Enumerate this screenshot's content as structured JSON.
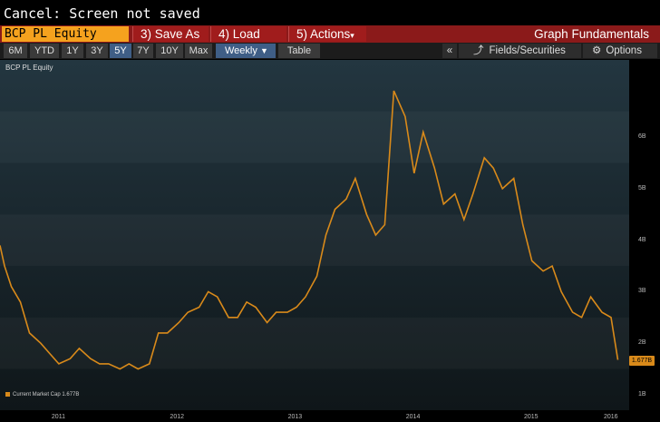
{
  "window": {
    "status_line": "Cancel: Screen not saved"
  },
  "command_bar": {
    "ticker": "BCP PL Equity",
    "save_as": "3) Save As",
    "load": "4) Load",
    "actions": "5) Actions",
    "function_title": "Graph Fundamentals"
  },
  "range_bar": {
    "ranges": [
      "6M",
      "YTD",
      "1Y",
      "3Y",
      "5Y",
      "7Y",
      "10Y",
      "Max"
    ],
    "active_range": "5Y",
    "frequency": "Weekly",
    "table_label": "Table",
    "collapse_label": "«",
    "fields_label": "Fields/Securities",
    "options_label": "Options"
  },
  "chart_data": {
    "type": "line",
    "security_label": "BCP PL Equity",
    "series": [
      {
        "name": "Current Market Cap",
        "last_value_label": "1.677B",
        "color": "#d98a1a",
        "x": [
          "2010-12-31",
          "2011-01-14",
          "2011-02-04",
          "2011-03-04",
          "2011-04-01",
          "2011-05-06",
          "2011-06-03",
          "2011-07-01",
          "2011-08-05",
          "2011-09-02",
          "2011-10-07",
          "2011-11-04",
          "2011-12-02",
          "2012-01-06",
          "2012-02-03",
          "2012-03-02",
          "2012-04-06",
          "2012-05-04",
          "2012-06-01",
          "2012-07-06",
          "2012-08-03",
          "2012-09-07",
          "2012-10-05",
          "2012-11-02",
          "2012-12-07",
          "2013-01-04",
          "2013-02-01",
          "2013-03-01",
          "2013-04-05",
          "2013-05-03",
          "2013-06-07",
          "2013-07-05",
          "2013-08-02",
          "2013-09-06",
          "2013-10-04",
          "2013-11-01",
          "2013-12-06",
          "2014-01-03",
          "2014-02-07",
          "2014-03-07",
          "2014-04-04",
          "2014-05-02",
          "2014-06-06",
          "2014-07-04",
          "2014-08-01",
          "2014-09-05",
          "2014-10-03",
          "2014-11-07",
          "2014-12-05",
          "2015-01-02",
          "2015-02-06",
          "2015-03-06",
          "2015-04-03",
          "2015-05-08",
          "2015-06-05",
          "2015-07-03",
          "2015-08-07",
          "2015-09-04",
          "2015-10-02",
          "2015-11-06",
          "2015-12-04",
          "2016-01-01",
          "2016-02-05",
          "2016-03-04",
          "2016-03-25"
        ],
        "values": [
          3.9,
          3.5,
          3.1,
          2.8,
          2.2,
          2.0,
          1.8,
          1.6,
          1.7,
          1.9,
          1.7,
          1.6,
          1.6,
          1.5,
          1.6,
          1.5,
          1.6,
          2.2,
          2.2,
          2.4,
          2.6,
          2.7,
          3.0,
          2.9,
          2.5,
          2.5,
          2.8,
          2.7,
          2.4,
          2.6,
          2.6,
          2.7,
          2.9,
          3.3,
          4.1,
          4.6,
          4.8,
          5.2,
          4.5,
          4.1,
          4.3,
          6.9,
          6.4,
          5.3,
          6.1,
          5.4,
          4.7,
          4.9,
          4.4,
          4.9,
          5.6,
          5.4,
          5.0,
          5.2,
          4.3,
          3.6,
          3.4,
          3.5,
          3.0,
          2.6,
          2.5,
          2.9,
          2.6,
          2.5,
          1.677
        ]
      }
    ],
    "y_ticks": [
      "1B",
      "2B",
      "3B",
      "4B",
      "5B",
      "6B"
    ],
    "y_range": [
      0.7,
      7.5
    ],
    "x_range": [
      "2010-12-31",
      "2016-04-29"
    ],
    "x_ticks": [
      "2011",
      "2012",
      "2013",
      "2014",
      "2015",
      "2016"
    ],
    "legend_label": "Current Market Cap 1.677B",
    "legend_position": "bottom-left",
    "grid": false
  }
}
